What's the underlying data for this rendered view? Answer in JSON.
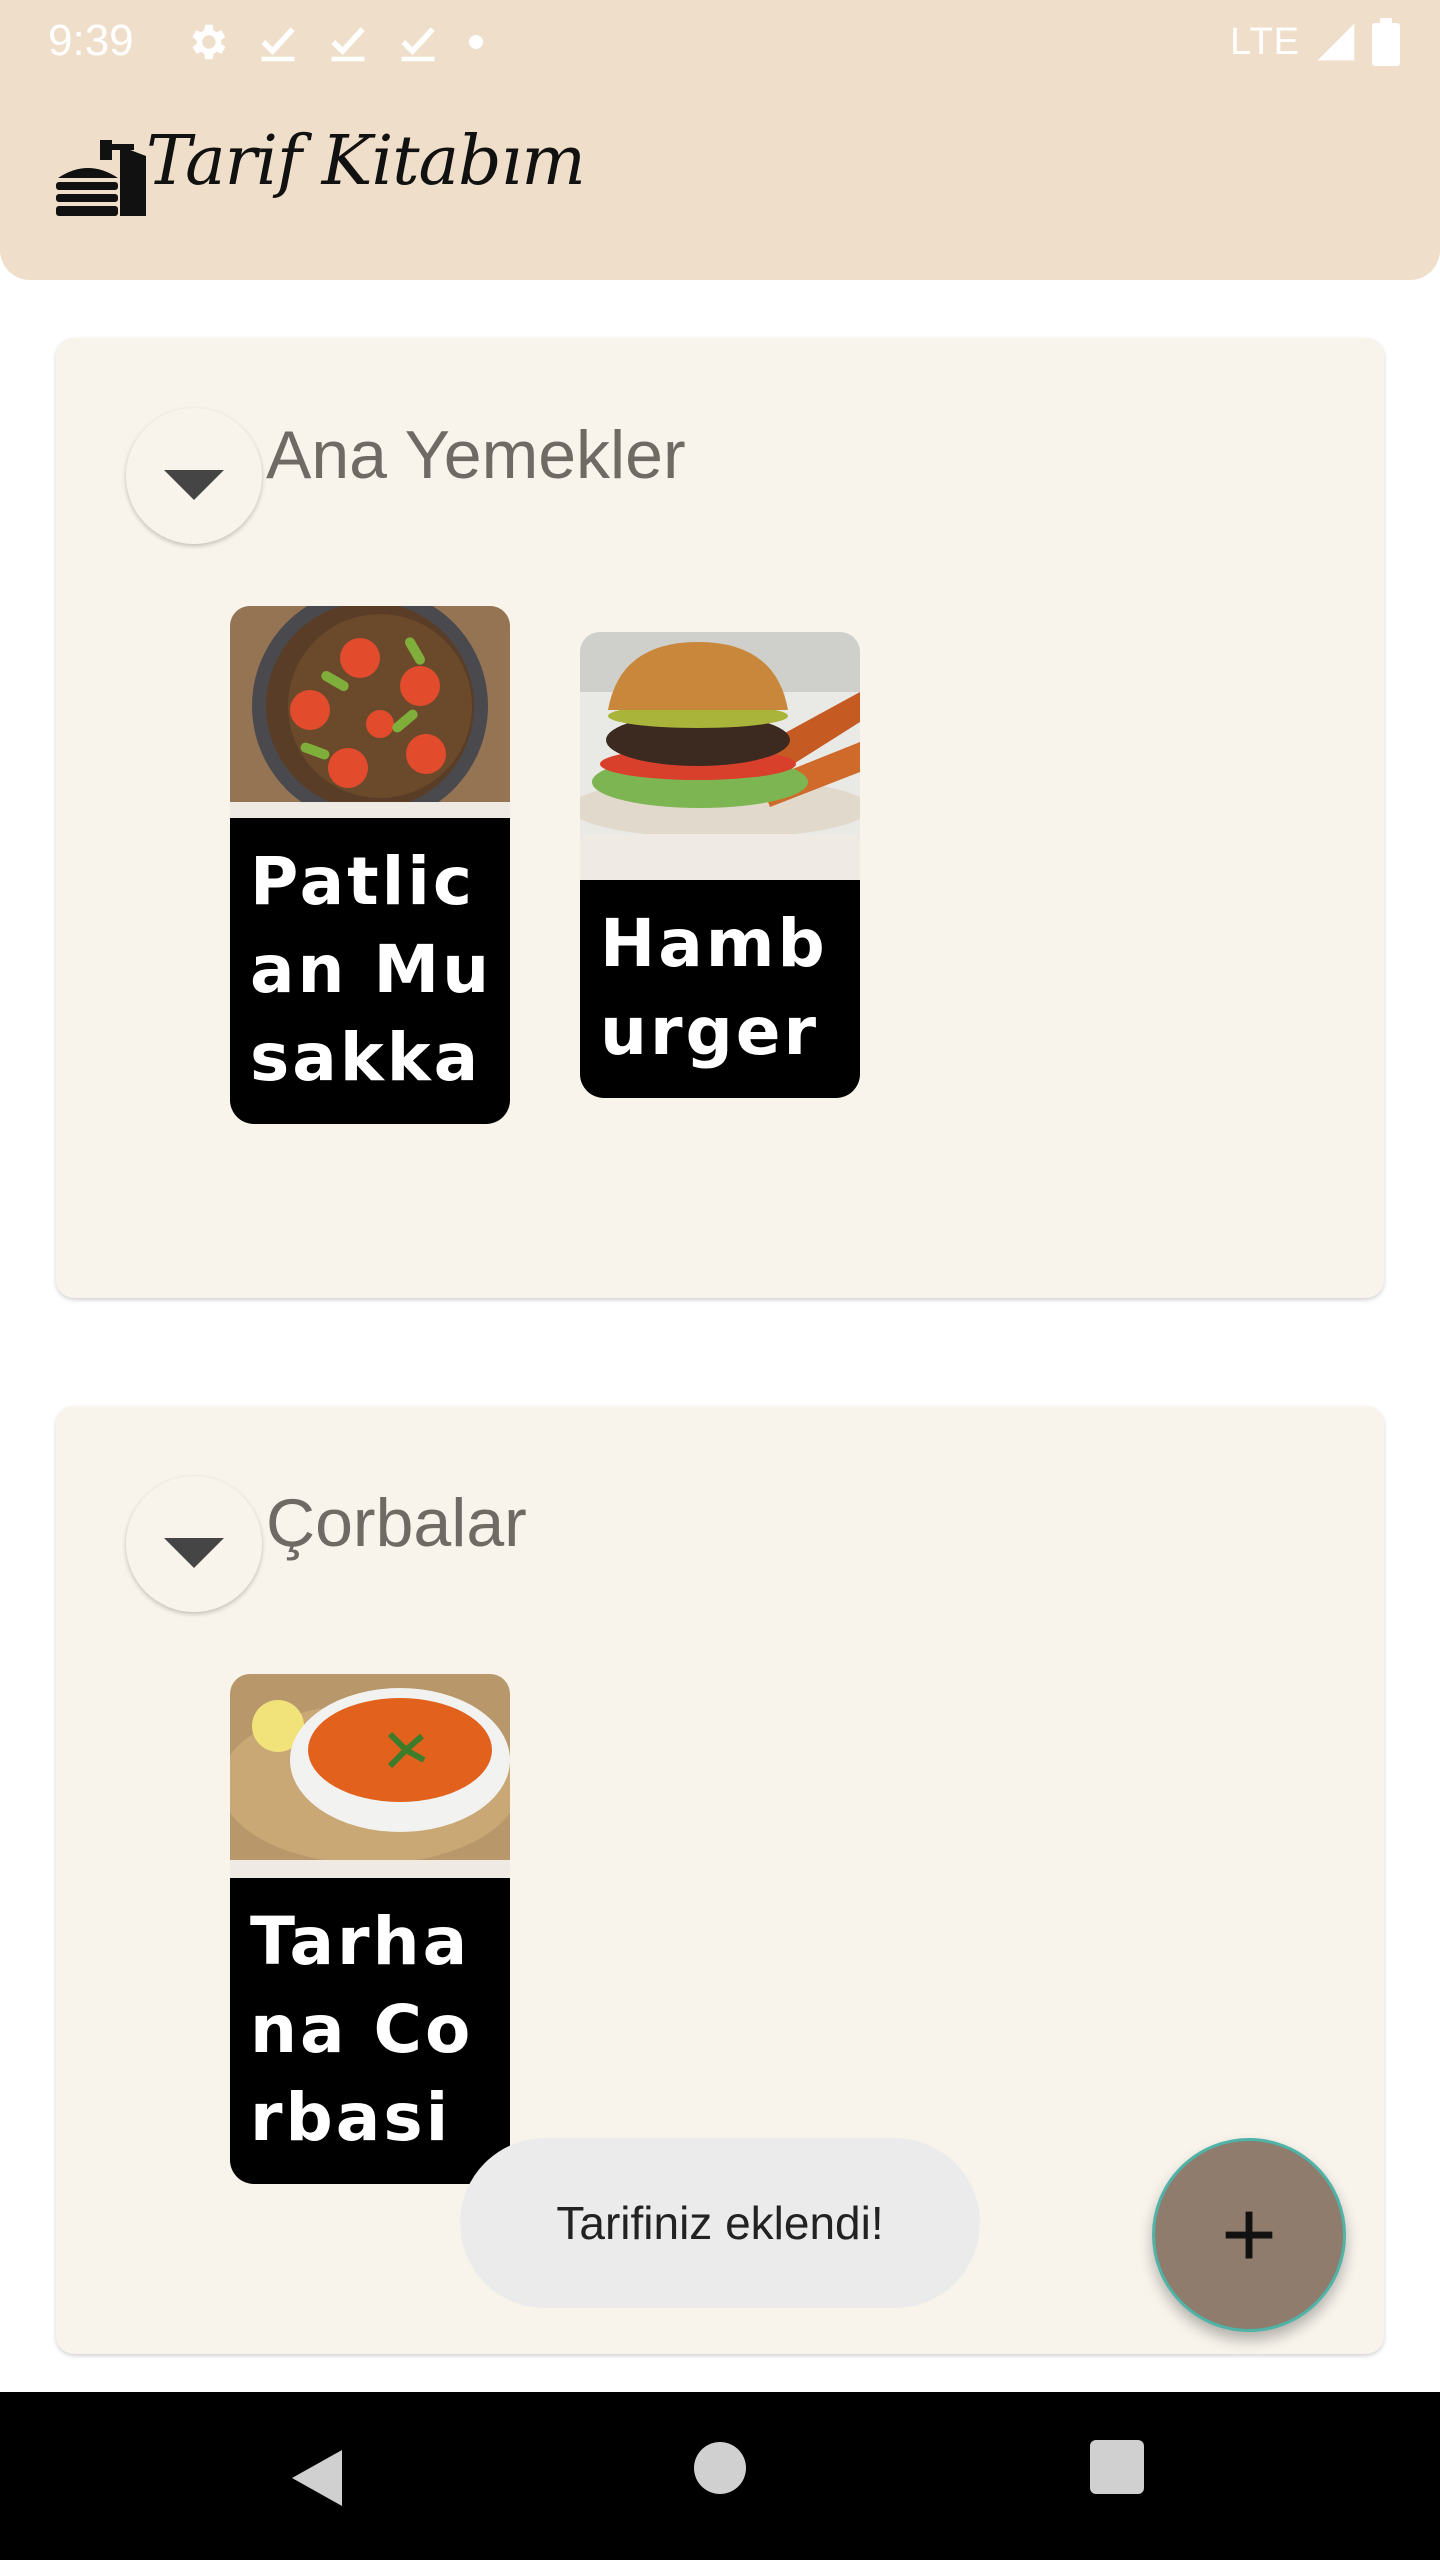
{
  "status_bar": {
    "time": "9:39",
    "network": "LTE",
    "icons": [
      "gear-icon",
      "check-icon",
      "check-icon",
      "check-icon",
      "dot-icon",
      "signal-icon",
      "battery-icon"
    ]
  },
  "app_bar": {
    "title": "Tarif Kitabım",
    "logo_icon": "food-cover-icon",
    "background": "#efdfca"
  },
  "categories": [
    {
      "title": "Ana Yemekler",
      "recipes": [
        {
          "name": "Patlican Musakka",
          "image": "eggplant-dish"
        },
        {
          "name": "Hamburger",
          "image": "burger"
        }
      ]
    },
    {
      "title": "Çorbalar",
      "recipes": [
        {
          "name": "Tarhana Corbasi",
          "image": "soup-bowl"
        }
      ]
    }
  ],
  "snackbar": {
    "message": "Tarifiniz eklendi!"
  },
  "fab": {
    "label": "+",
    "icon": "plus-icon",
    "color": "#8f7c6c"
  },
  "nav_bar": {
    "icons": [
      "back-icon",
      "home-icon",
      "recents-icon"
    ]
  }
}
